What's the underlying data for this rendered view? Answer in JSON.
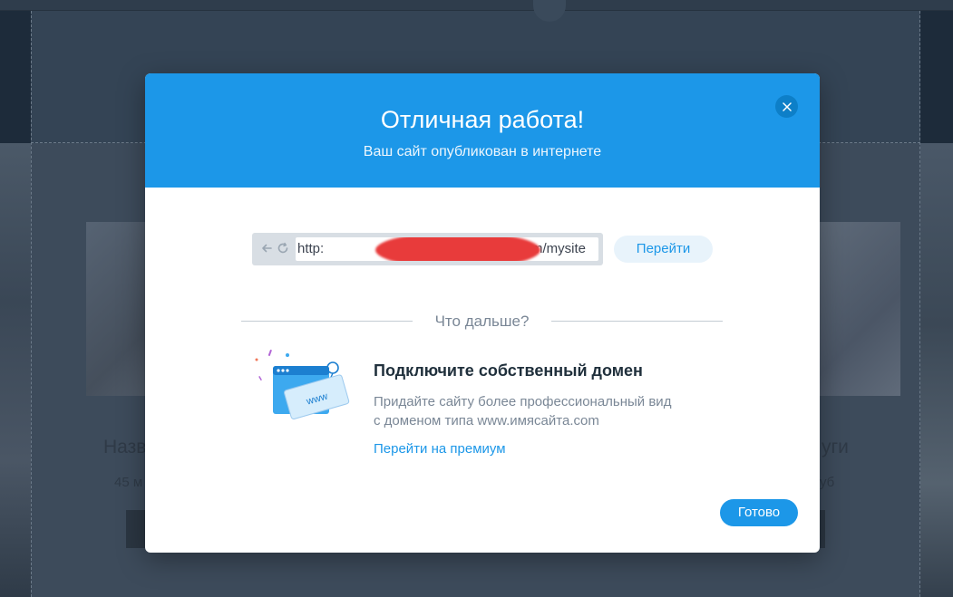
{
  "background": {
    "card_left_title": "Назв",
    "card_left_meta": "45 м",
    "card_right_title": "уги",
    "card_right_meta": "уб"
  },
  "modal": {
    "title": "Отличная работа!",
    "subtitle": "Ваш сайт опубликован в интернете",
    "close_icon": "close-icon",
    "url_prefix": "http:",
    "url_suffix": "m/mysite",
    "go_label": "Перейти",
    "divider_text": "Что дальше?",
    "promo": {
      "icon": "domain-browser-illustration",
      "illustration_text": "www",
      "title": "Подключите собственный домен",
      "desc_line1": "Придайте сайту более профессиональный вид",
      "desc_line2": "с доменом типа www.имясайта.com",
      "link_label": "Перейти на премиум"
    },
    "done_label": "Готово"
  },
  "colors": {
    "accent": "#1c97e8",
    "header_bg": "#1c97e8",
    "close_bg": "#0d7fc8",
    "redaction": "#e83b3b",
    "overlay_bg": "#3c4a5a"
  }
}
